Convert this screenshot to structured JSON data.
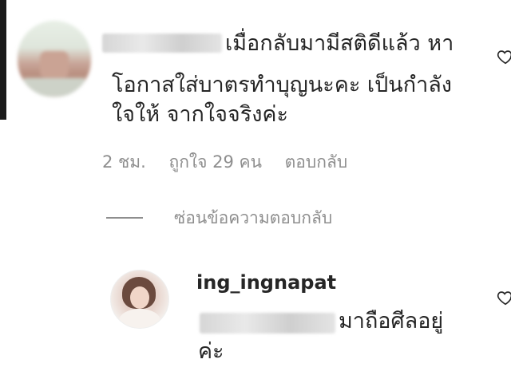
{
  "comment": {
    "text_line1": "เมื่อกลับมามีสติดีแล้ว หา",
    "text_line2": "โอกาสใส่บาตรทำบุญนะคะ เป็นกำลัง",
    "text_line3": "ใจให้ จากใจจริงค่ะ",
    "time": "2 ชม.",
    "likes": "ถูกใจ 29 คน",
    "reply_label": "ตอบกลับ"
  },
  "replies_toggle": {
    "label": "ซ่อนข้อความตอบกลับ"
  },
  "reply": {
    "username": "ing_ingnapat",
    "text_line1": "มาถือศีลอยู่",
    "text_line2": "ค่ะ"
  },
  "icons": {
    "like": "heart-outline-icon"
  }
}
